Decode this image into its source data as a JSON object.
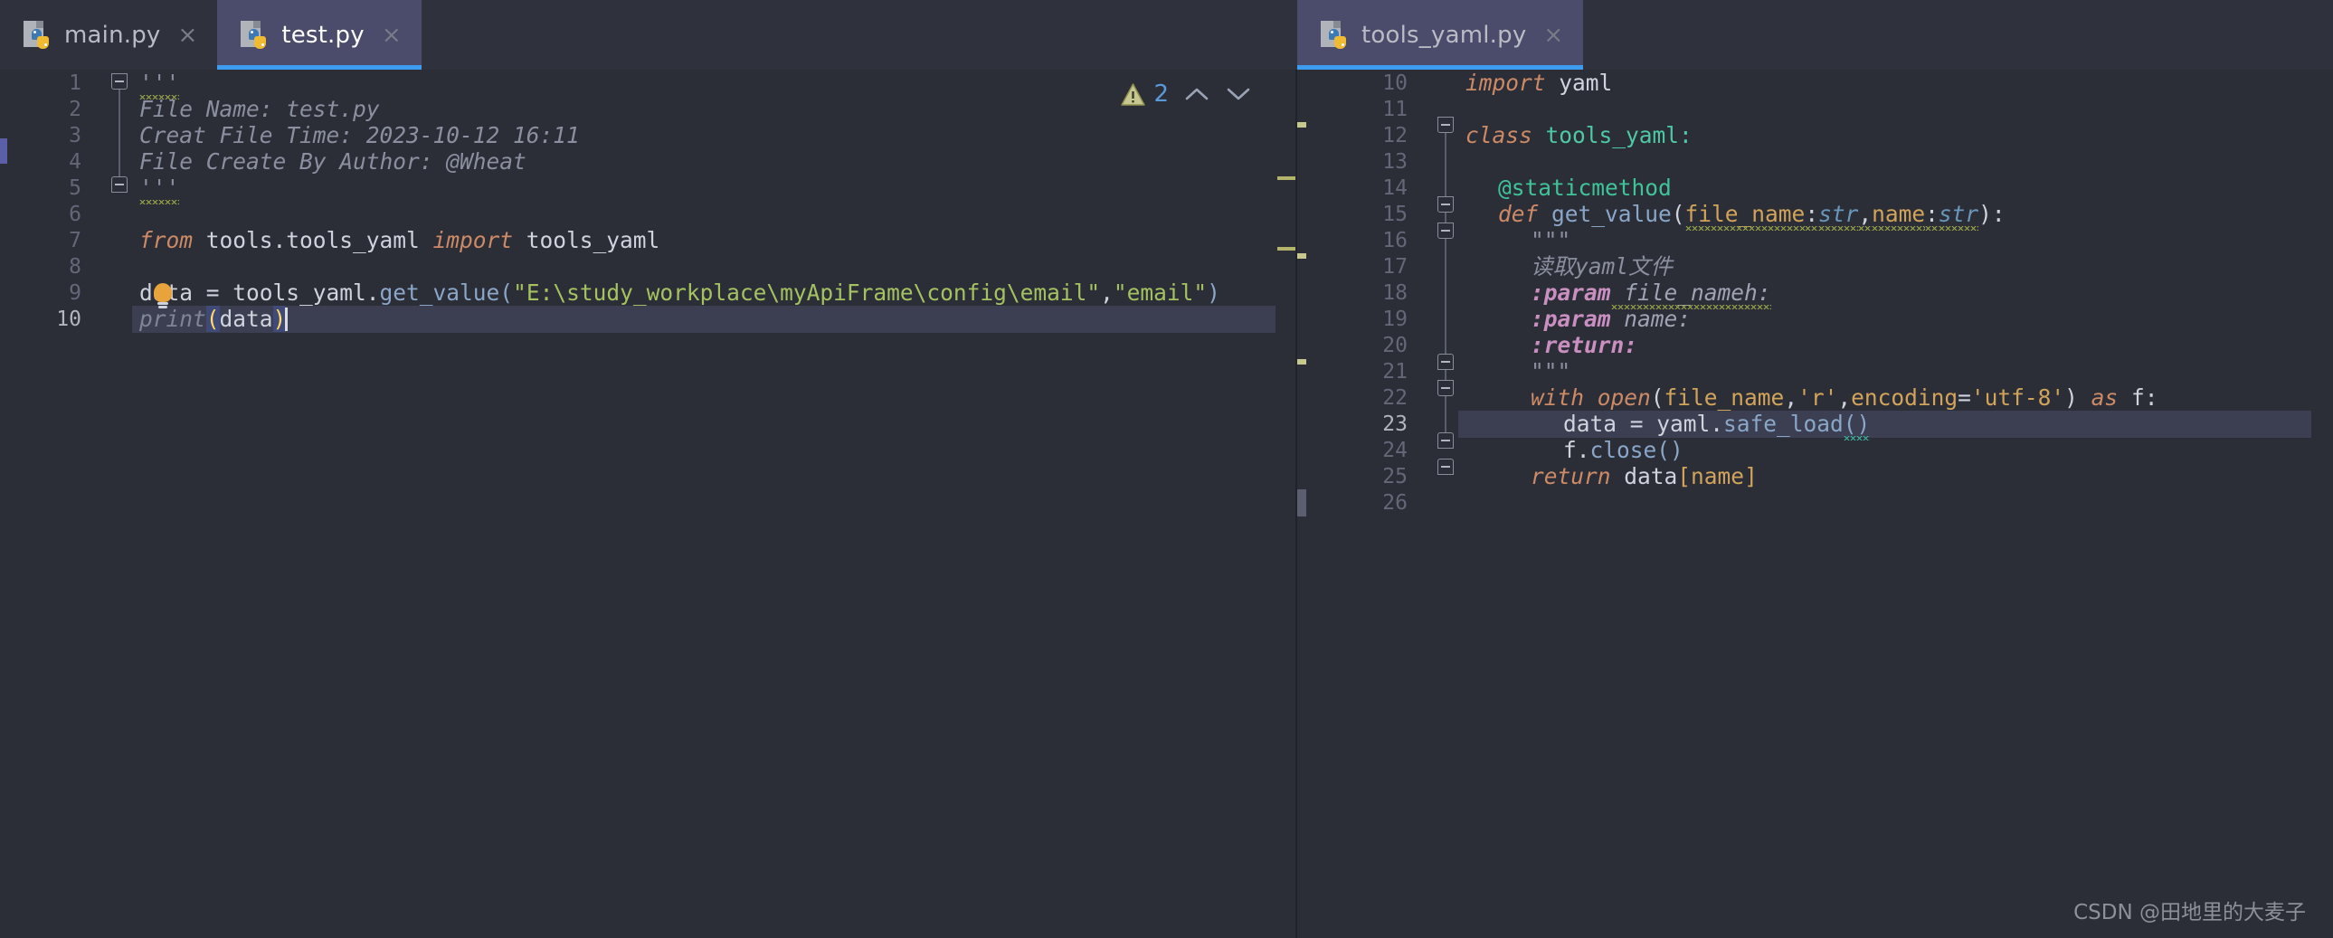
{
  "window": {
    "background": "#2b2d37",
    "accent": "#3d9bf0"
  },
  "tabs_left": [
    {
      "label": "main.py",
      "icon": "python-file-icon",
      "close": "×",
      "active": false
    },
    {
      "label": "test.py",
      "icon": "python-file-icon",
      "close": "×",
      "active": true
    }
  ],
  "tabs_right": [
    {
      "label": "tools_yaml.py",
      "icon": "python-file-icon",
      "close": "×",
      "active": true
    }
  ],
  "inspection": {
    "warning_icon": "warning-triangle-icon",
    "warning_count": "2",
    "prev_icon": "chevron-up-icon",
    "next_icon": "chevron-down-icon"
  },
  "left_editor": {
    "file": "test.py",
    "first_line": 1,
    "current_line": 10,
    "line_numbers": [
      "1",
      "2",
      "3",
      "4",
      "5",
      "6",
      "7",
      "8",
      "9",
      "10"
    ],
    "lines": [
      {
        "n": 1,
        "text": "'''"
      },
      {
        "n": 2,
        "text": "File Name: test.py"
      },
      {
        "n": 3,
        "text": "Creat File Time: 2023-10-12 16:11"
      },
      {
        "n": 4,
        "text": "File Create By Author: @Wheat"
      },
      {
        "n": 5,
        "text": "'''"
      },
      {
        "n": 6,
        "text": ""
      },
      {
        "n": 7,
        "text": "from tools.tools_yaml import tools_yaml"
      },
      {
        "n": 8,
        "text": ""
      },
      {
        "n": 9,
        "text": "data = tools_yaml.get_value(\"E:\\study_workplace\\myApiFrame\\config\\email\",\"email\")"
      },
      {
        "n": 10,
        "text": "print(data)"
      }
    ],
    "tokens": {
      "l2": "File Name: test.py",
      "l3": "Creat File Time: 2023-10-12 16:11",
      "l4": "File Create By Author: @Wheat",
      "l7_from": "from",
      "l7_module": " tools.tools_yaml ",
      "l7_import": "import",
      "l7_name": " tools_yaml",
      "l9_var": "data = ",
      "l9_obj": "tools_yaml.",
      "l9_fn": "get_value",
      "l9_open": "(",
      "l9_str1": "\"E:\\study_workplace\\myApiFrame\\config\\email\"",
      "l9_comma": ",",
      "l9_str2": "\"email\"",
      "l9_close": ")",
      "l10_fn": "print",
      "l10_open": "(",
      "l10_arg": "data",
      "l10_close": ")"
    },
    "quote_marks": "'''",
    "lightbulb_icon": "intention-bulb-icon"
  },
  "right_editor": {
    "file": "tools_yaml.py",
    "first_line": 10,
    "current_line": 23,
    "line_numbers": [
      "10",
      "11",
      "12",
      "13",
      "14",
      "15",
      "16",
      "17",
      "18",
      "19",
      "20",
      "21",
      "22",
      "23",
      "24",
      "25",
      "26"
    ],
    "lines": [
      {
        "n": 10,
        "text": "import yaml"
      },
      {
        "n": 11,
        "text": ""
      },
      {
        "n": 12,
        "text": "class tools_yaml:"
      },
      {
        "n": 13,
        "text": ""
      },
      {
        "n": 14,
        "text": "    @staticmethod"
      },
      {
        "n": 15,
        "text": "    def get_value(file_name:str,name:str):"
      },
      {
        "n": 16,
        "text": "        \"\"\""
      },
      {
        "n": 17,
        "text": "        读取yaml文件"
      },
      {
        "n": 18,
        "text": "        :param file_nameh:"
      },
      {
        "n": 19,
        "text": "        :param name:"
      },
      {
        "n": 20,
        "text": "        :return:"
      },
      {
        "n": 21,
        "text": "        \"\"\""
      },
      {
        "n": 22,
        "text": "        with open(file_name,'r',encoding='utf-8') as f:"
      },
      {
        "n": 23,
        "text": "            data = yaml.safe_load()"
      },
      {
        "n": 24,
        "text": "            f.close()"
      },
      {
        "n": 25,
        "text": "        return data[name]"
      },
      {
        "n": 26,
        "text": ""
      }
    ],
    "tokens": {
      "l10_kw": "import",
      "l10_mod": " yaml",
      "l12_kw": "class",
      "l12_name": " tools_yaml",
      "l12_colon": ":",
      "l14_deco": "@staticmethod",
      "l15_kw": "def",
      "l15_fn": " get_value",
      "l15_open": "(",
      "l15_p1": "file_name",
      "l15_c1": ":",
      "l15_t1": "str",
      "l15_comma": ",",
      "l15_p2": "name",
      "l15_c2": ":",
      "l15_t2": "str",
      "l15_close": "):",
      "l16_doc": "\"\"\"",
      "l17_doc": "读取yaml文件",
      "l18_param": ":param",
      "l18_name": " file_nameh:",
      "l19_param": ":param",
      "l19_name": " name:",
      "l20_ret": ":return:",
      "l21_doc": "\"\"\"",
      "l22_with": "with",
      "l22_open": " open",
      "l22_paren": "(",
      "l22_arg": "file_name",
      "l22_c1": ",",
      "l22_s1": "'r'",
      "l22_c2": ",",
      "l22_enc": "encoding",
      "l22_eq": "=",
      "l22_s2": "'utf-8'",
      "l22_cp": ")",
      "l22_as": " as",
      "l22_f": " f:",
      "l23_var": "data = ",
      "l23_obj": "yaml.",
      "l23_fn": "safe_load",
      "l23_call": "()",
      "l24_obj": "f.",
      "l24_fn": "close",
      "l24_call": "()",
      "l25_kw": "return",
      "l25_var": " data",
      "l25_ob": "[",
      "l25_idx": "name",
      "l25_cb": "]"
    }
  },
  "watermark": "CSDN @田地里的大麦子"
}
